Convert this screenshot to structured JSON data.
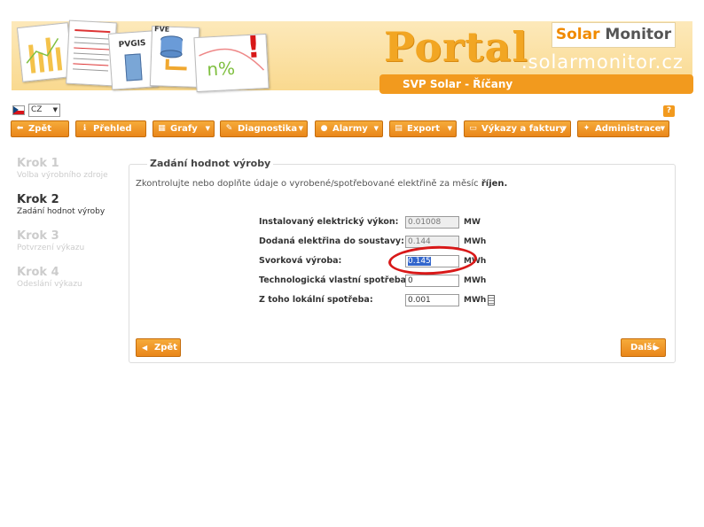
{
  "header": {
    "portal_word": "Portal",
    "domain": ".solarmonitor.cz",
    "brand_solar": "Solar",
    "brand_monitor": "Monitor",
    "subtitle": "SVP Solar - Říčany",
    "thumb_labels": [
      "PVGIS",
      "FVE",
      "n%",
      "!"
    ]
  },
  "language": {
    "selected": "CZ"
  },
  "help_label": "?",
  "nav": {
    "items": [
      {
        "label": "Zpět",
        "icon": "arrow-left-icon",
        "dropdown": false
      },
      {
        "label": "Přehled",
        "icon": "info-icon",
        "dropdown": false
      },
      {
        "label": "Grafy",
        "icon": "chart-icon",
        "dropdown": true
      },
      {
        "label": "Diagnostika",
        "icon": "wrench-icon",
        "dropdown": true
      },
      {
        "label": "Alarmy",
        "icon": "alarm-icon",
        "dropdown": true
      },
      {
        "label": "Export",
        "icon": "export-icon",
        "dropdown": true
      },
      {
        "label": "Výkazy a faktury",
        "icon": "printer-icon",
        "dropdown": true
      },
      {
        "label": "Administrace",
        "icon": "tools-icon",
        "dropdown": true
      }
    ]
  },
  "steps": [
    {
      "title": "Krok 1",
      "sub": "Volba výrobního zdroje",
      "active": false
    },
    {
      "title": "Krok 2",
      "sub": "Zadání hodnot výroby",
      "active": true
    },
    {
      "title": "Krok 3",
      "sub": "Potvrzení výkazu",
      "active": false
    },
    {
      "title": "Krok 4",
      "sub": "Odeslání výkazu",
      "active": false
    }
  ],
  "form": {
    "legend": "Zadání hodnot výroby",
    "intro": "Zkontrolujte nebo doplňte údaje o vyrobené/spotřebované elektřině za měsíc",
    "intro_month": "říjen.",
    "rows": [
      {
        "label": "Instalovaný elektrický výkon:",
        "value": "0.01008",
        "unit": "MW",
        "readonly": true
      },
      {
        "label": "Dodaná elektřina do soustavy:",
        "value": "0.144",
        "unit": "MWh",
        "readonly": true
      },
      {
        "label": "Svorková výroba:",
        "value": "0.145",
        "unit": "MWh",
        "readonly": false
      },
      {
        "label": "Technologická vlastní spotřeba:",
        "value": "0",
        "unit": "MWh",
        "readonly": false
      },
      {
        "label": "Z toho lokální spotřeba:",
        "value": "0.001",
        "unit": "MWh",
        "readonly": false
      }
    ],
    "back_label": "Zpět",
    "next_label": "Další"
  },
  "colors": {
    "accent": "#f29a1e",
    "highlight": "#d81818"
  }
}
